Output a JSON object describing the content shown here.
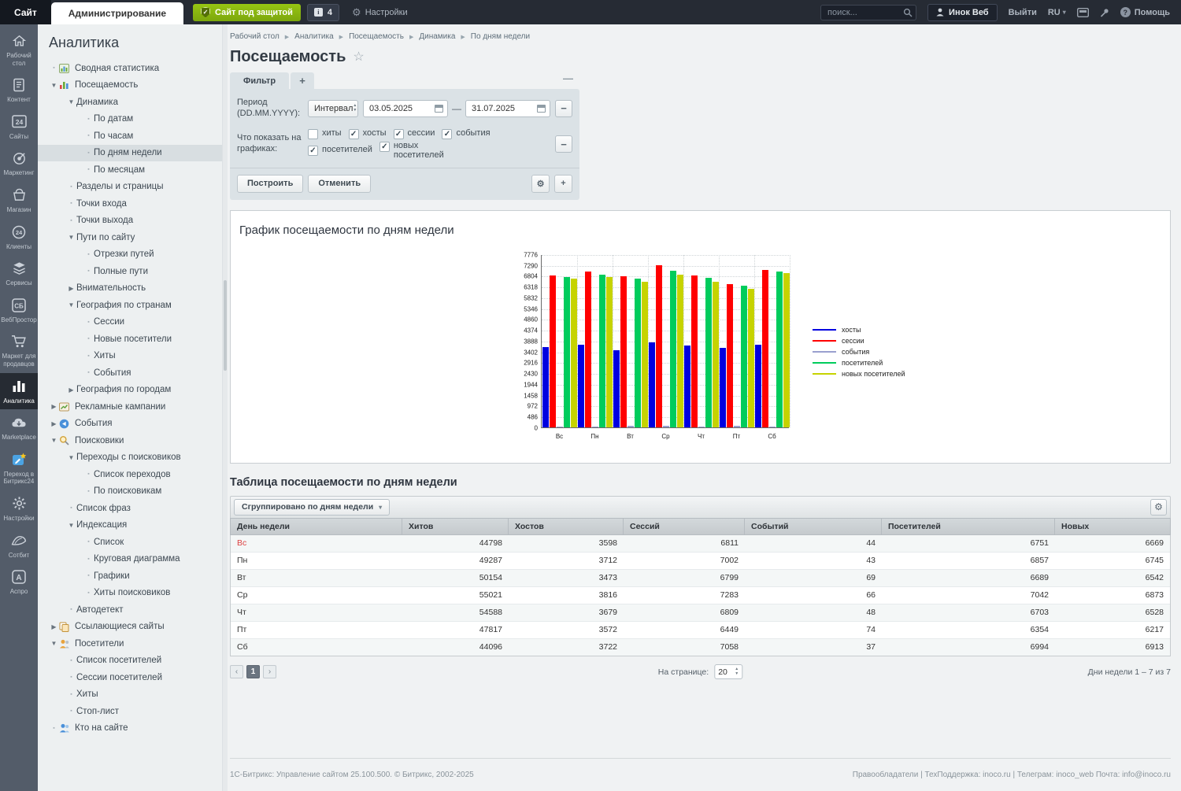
{
  "topbar": {
    "site_tab": "Сайт",
    "admin_tab": "Администрирование",
    "protected_label": "Сайт под защитой",
    "alerts_count": "4",
    "settings_label": "Настройки",
    "search_placeholder": "поиск...",
    "user_name": "Инок Веб",
    "logout_label": "Выйти",
    "lang": "RU",
    "help_label": "Помощь"
  },
  "rail": {
    "items": [
      {
        "icon": "home",
        "label": "Рабочий стол",
        "active": false
      },
      {
        "icon": "document",
        "label": "Контент",
        "active": false
      },
      {
        "icon": "sites24",
        "label": "Сайты",
        "active": false
      },
      {
        "icon": "target",
        "label": "Маркетинг",
        "active": false
      },
      {
        "icon": "basket",
        "label": "Магазин",
        "active": false
      },
      {
        "icon": "clients24",
        "label": "Клиенты",
        "active": false
      },
      {
        "icon": "layers",
        "label": "Сервисы",
        "active": false
      },
      {
        "icon": "webspace",
        "label": "ВебПростор",
        "active": false
      },
      {
        "icon": "cart",
        "label": "Маркет для продавцов",
        "active": false
      },
      {
        "icon": "analytics",
        "label": "Аналитика",
        "active": true
      },
      {
        "icon": "cloud",
        "label": "Marketplace",
        "active": false
      },
      {
        "icon": "b24",
        "label": "Переход в Битрикс24",
        "active": false
      },
      {
        "icon": "gear",
        "label": "Настройки",
        "active": false
      },
      {
        "icon": "sotbit",
        "label": "Сотбит",
        "active": false
      },
      {
        "icon": "aspro",
        "label": "Аспро",
        "active": false
      }
    ]
  },
  "menu": {
    "title": "Аналитика",
    "items": [
      {
        "label": "Сводная статистика",
        "level": 0,
        "marker": "leaf",
        "icon": "summary"
      },
      {
        "label": "Посещаемость",
        "level": 0,
        "marker": "expanded",
        "icon": "visits"
      },
      {
        "label": "Динамика",
        "level": 1,
        "marker": "expanded"
      },
      {
        "label": "По датам",
        "level": 2,
        "marker": "leaf"
      },
      {
        "label": "По часам",
        "level": 2,
        "marker": "leaf"
      },
      {
        "label": "По дням недели",
        "level": 2,
        "marker": "leaf",
        "selected": true
      },
      {
        "label": "По месяцам",
        "level": 2,
        "marker": "leaf"
      },
      {
        "label": "Разделы и страницы",
        "level": 1,
        "marker": "leaf"
      },
      {
        "label": "Точки входа",
        "level": 1,
        "marker": "leaf"
      },
      {
        "label": "Точки выхода",
        "level": 1,
        "marker": "leaf"
      },
      {
        "label": "Пути по сайту",
        "level": 1,
        "marker": "expanded"
      },
      {
        "label": "Отрезки путей",
        "level": 2,
        "marker": "leaf"
      },
      {
        "label": "Полные пути",
        "level": 2,
        "marker": "leaf"
      },
      {
        "label": "Внимательность",
        "level": 1,
        "marker": "collapsed"
      },
      {
        "label": "География по странам",
        "level": 1,
        "marker": "expanded"
      },
      {
        "label": "Сессии",
        "level": 2,
        "marker": "leaf"
      },
      {
        "label": "Новые посетители",
        "level": 2,
        "marker": "leaf"
      },
      {
        "label": "Хиты",
        "level": 2,
        "marker": "leaf"
      },
      {
        "label": "События",
        "level": 2,
        "marker": "leaf"
      },
      {
        "label": "География по городам",
        "level": 1,
        "marker": "collapsed"
      },
      {
        "label": "Рекламные кампании",
        "level": 0,
        "marker": "collapsed",
        "icon": "adv"
      },
      {
        "label": "События",
        "level": 0,
        "marker": "collapsed",
        "icon": "events"
      },
      {
        "label": "Поисковики",
        "level": 0,
        "marker": "expanded",
        "icon": "searchers"
      },
      {
        "label": "Переходы с поисковиков",
        "level": 1,
        "marker": "expanded"
      },
      {
        "label": "Список переходов",
        "level": 2,
        "marker": "leaf"
      },
      {
        "label": "По поисковикам",
        "level": 2,
        "marker": "leaf"
      },
      {
        "label": "Список фраз",
        "level": 1,
        "marker": "leaf"
      },
      {
        "label": "Индексация",
        "level": 1,
        "marker": "expanded"
      },
      {
        "label": "Список",
        "level": 2,
        "marker": "leaf"
      },
      {
        "label": "Круговая диаграмма",
        "level": 2,
        "marker": "leaf"
      },
      {
        "label": "Графики",
        "level": 2,
        "marker": "leaf"
      },
      {
        "label": "Хиты поисковиков",
        "level": 2,
        "marker": "leaf"
      },
      {
        "label": "Автодетект",
        "level": 1,
        "marker": "leaf"
      },
      {
        "label": "Ссылающиеся сайты",
        "level": 0,
        "marker": "collapsed",
        "icon": "refsites"
      },
      {
        "label": "Посетители",
        "level": 0,
        "marker": "expanded",
        "icon": "visitors"
      },
      {
        "label": "Список посетителей",
        "level": 1,
        "marker": "leaf"
      },
      {
        "label": "Сессии посетителей",
        "level": 1,
        "marker": "leaf"
      },
      {
        "label": "Хиты",
        "level": 1,
        "marker": "leaf"
      },
      {
        "label": "Стоп-лист",
        "level": 1,
        "marker": "leaf"
      },
      {
        "label": "Кто на сайте",
        "level": 0,
        "marker": "leaf",
        "icon": "whois"
      }
    ]
  },
  "breadcrumb": {
    "items": [
      "Рабочий стол",
      "Аналитика",
      "Посещаемость",
      "Динамика",
      "По дням недели"
    ]
  },
  "page": {
    "title": "Посещаемость"
  },
  "filter": {
    "tab_label": "Фильтр",
    "add_tab_label": "+",
    "collapse_glyph": "—",
    "period_label": "Период (DD.MM.YYYY):",
    "interval_value": "Интервал",
    "date_from": "03.05.2025",
    "date_to": "31.07.2025",
    "show_label": "Что показать на графиках:",
    "checkboxes": [
      {
        "label": "хиты",
        "checked": false
      },
      {
        "label": "хосты",
        "checked": true
      },
      {
        "label": "сессии",
        "checked": true
      },
      {
        "label": "события",
        "checked": true
      },
      {
        "label": "посетителей",
        "checked": true
      },
      {
        "label": "новых посетителей",
        "checked": true
      }
    ],
    "build_label": "Построить",
    "cancel_label": "Отменить"
  },
  "chart_panel": {
    "title": "График посещаемости по дням недели"
  },
  "chart_data": {
    "type": "bar",
    "title": "График посещаемости по дням недели",
    "categories": [
      "Вс",
      "Пн",
      "Вт",
      "Ср",
      "Чт",
      "Пт",
      "Сб"
    ],
    "series": [
      {
        "name": "хосты",
        "color": "#0000e0",
        "values": [
          3598,
          3712,
          3473,
          3816,
          3679,
          3572,
          3722
        ]
      },
      {
        "name": "сессии",
        "color": "#ff0000",
        "values": [
          6811,
          7002,
          6799,
          7283,
          6809,
          6449,
          7058
        ]
      },
      {
        "name": "события",
        "color": "#9aa0cf",
        "values": [
          44,
          43,
          69,
          66,
          48,
          74,
          37
        ]
      },
      {
        "name": "посетителей",
        "color": "#00cc5c",
        "values": [
          6751,
          6857,
          6689,
          7042,
          6703,
          6354,
          6994
        ]
      },
      {
        "name": "новых посетителей",
        "color": "#c6d300",
        "values": [
          6669,
          6745,
          6542,
          6873,
          6528,
          6217,
          6913
        ]
      }
    ],
    "ylim": [
      0,
      7776
    ],
    "ytick_step": 486,
    "grid": true,
    "legend_position": "right",
    "xlabel": "",
    "ylabel": ""
  },
  "table_section": {
    "title": "Таблица посещаемости по дням недели",
    "group_button": "Сгруппировано по дням недели",
    "headers": [
      "День недели",
      "Хитов",
      "Хостов",
      "Сессий",
      "Событий",
      "Посетителей",
      "Новых"
    ],
    "rows": [
      {
        "day": "Вс",
        "values": [
          "44798",
          "3598",
          "6811",
          "44",
          "6751",
          "6669"
        ]
      },
      {
        "day": "Пн",
        "values": [
          "49287",
          "3712",
          "7002",
          "43",
          "6857",
          "6745"
        ]
      },
      {
        "day": "Вт",
        "values": [
          "50154",
          "3473",
          "6799",
          "69",
          "6689",
          "6542"
        ]
      },
      {
        "day": "Ср",
        "values": [
          "55021",
          "3816",
          "7283",
          "66",
          "7042",
          "6873"
        ]
      },
      {
        "day": "Чт",
        "values": [
          "54588",
          "3679",
          "6809",
          "48",
          "6703",
          "6528"
        ]
      },
      {
        "day": "Пт",
        "values": [
          "47817",
          "3572",
          "6449",
          "74",
          "6354",
          "6217"
        ]
      },
      {
        "day": "Сб",
        "values": [
          "44096",
          "3722",
          "7058",
          "37",
          "6994",
          "6913"
        ]
      }
    ]
  },
  "pagination": {
    "prev": "‹",
    "page": "1",
    "next": "›",
    "per_page_label": "На странице:",
    "per_page": "20",
    "range_label": "Дни недели 1 – 7 из 7"
  },
  "footer": {
    "left": "1С-Битрикс: Управление сайтом 25.100.500. © Битрикс, 2002-2025",
    "right": "Правообладатели  |  ТехПоддержка: inoco.ru | Телеграм: inoco_web Почта: info@inoco.ru"
  }
}
